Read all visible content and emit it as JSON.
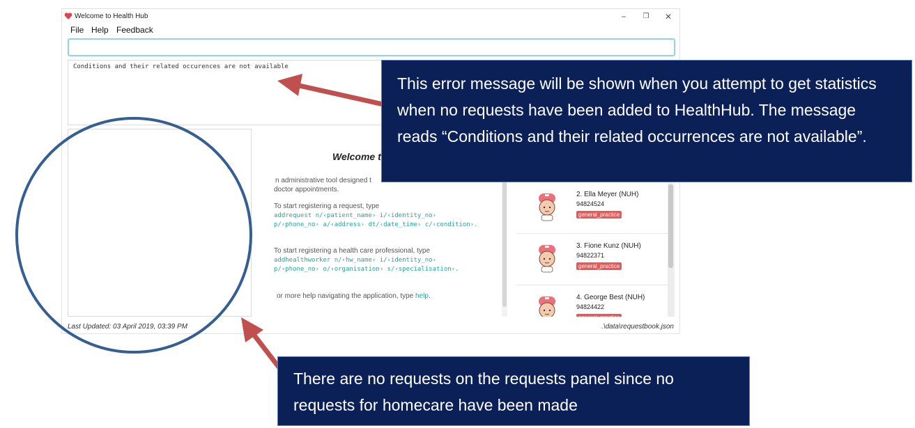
{
  "window": {
    "title": "Welcome to Health Hub",
    "controls": {
      "minimize": "−",
      "maximize": "❐",
      "close": "✕"
    }
  },
  "menu": [
    "File",
    "Help",
    "Feedback"
  ],
  "command_box": {
    "value": ""
  },
  "result_display": {
    "text": "Conditions and their related occurences are not available"
  },
  "welcome_panel": {
    "title": "Welcome to",
    "intro_line1": "n administrative tool designed t",
    "intro_line2": "doctor appointments.",
    "request_intro": "To start registering a request, type",
    "request_cmd1": "addrequest n/‹patient_name› i/‹identity_no›",
    "request_cmd2": "p/‹phone_no› a/‹address› dt/‹date_time› c/‹condition›.",
    "worker_intro": "To start registering a health care professional, type",
    "worker_cmd1": "addhealthworker n/‹hw_name› i/‹identity_no›",
    "worker_cmd2": "p/‹phone_no› o/‹organisation› s/‹specialisation›.",
    "help_prefix": "or more help navigating the application, type",
    "help_cmd": "help"
  },
  "health_workers": [
    {
      "name": "2.  Ella Meyer (NUH)",
      "phone": "94824524",
      "tag": "general_practice"
    },
    {
      "name": "3.  Fione Kunz (NUH)",
      "phone": "94822371",
      "tag": "general_practice"
    },
    {
      "name": "4.  George Best (NUH)",
      "phone": "94824422",
      "tag": "general_practice"
    }
  ],
  "status_bar": {
    "last_updated": "Last Updated: 03 April 2019, 03:39 PM",
    "file_path": ".\\data\\requestbook.json"
  },
  "callouts": {
    "error_message": "This error message will be shown when you attempt to get statistics when no requests have been added to HealthHub. The message reads “Conditions and their related occurrences  are not available”.",
    "empty_panel": "There are no requests on the requests panel since no requests for homecare have been made"
  },
  "colors": {
    "callout_bg": "#0a2057",
    "arrow": "#c0504d",
    "circle": "#355e93",
    "tag": "#ea5757",
    "code": "#2aa39a",
    "command_border": "#8fd3f0"
  }
}
